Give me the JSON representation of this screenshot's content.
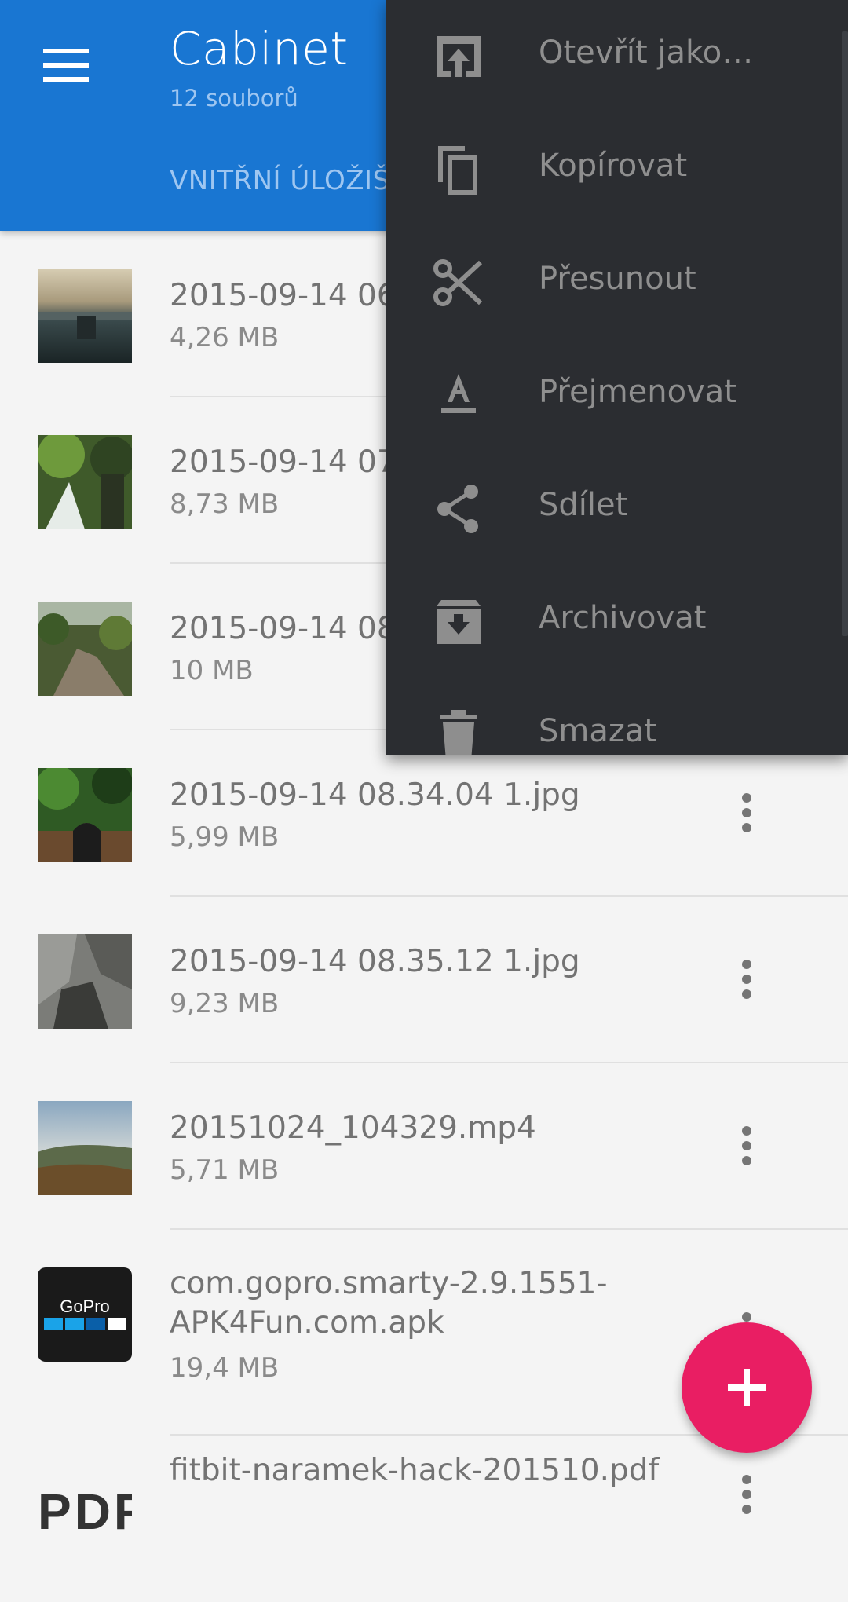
{
  "header": {
    "title": "Cabinet",
    "subtitle": "12 souborů",
    "storage_tab": "VNITŘNÍ ÚLOŽIŠ"
  },
  "files": [
    {
      "name": "2015-09-14 06",
      "size": "4,26 MB"
    },
    {
      "name": "2015-09-14 07",
      "size": "8,73 MB"
    },
    {
      "name": "2015-09-14 08",
      "size": "10 MB"
    },
    {
      "name": "2015-09-14 08.34.04 1.jpg",
      "size": "5,99 MB"
    },
    {
      "name": "2015-09-14 08.35.12 1.jpg",
      "size": "9,23 MB"
    },
    {
      "name": "20151024_104329.mp4",
      "size": "5,71 MB"
    },
    {
      "name": "com.gopro.smarty-2.9.1551-APK4Fun.com.apk",
      "size": "19,4 MB",
      "logo_text": "GoPro"
    },
    {
      "name": "fitbit-naramek-hack-201510.pdf",
      "size": "",
      "thumb_text": "PDF"
    }
  ],
  "context_menu": {
    "items": [
      {
        "label": "Otevřít jako…",
        "icon": "open-with-icon"
      },
      {
        "label": "Kopírovat",
        "icon": "copy-icon"
      },
      {
        "label": "Přesunout",
        "icon": "scissors-icon"
      },
      {
        "label": "Přejmenovat",
        "icon": "rename-icon"
      },
      {
        "label": "Sdílet",
        "icon": "share-icon"
      },
      {
        "label": "Archivovat",
        "icon": "archive-icon"
      },
      {
        "label": "Smazat",
        "icon": "delete-icon"
      }
    ]
  },
  "colors": {
    "appbar": "#1976d2",
    "menu_bg": "#2b2d31",
    "fab": "#e91e63"
  }
}
